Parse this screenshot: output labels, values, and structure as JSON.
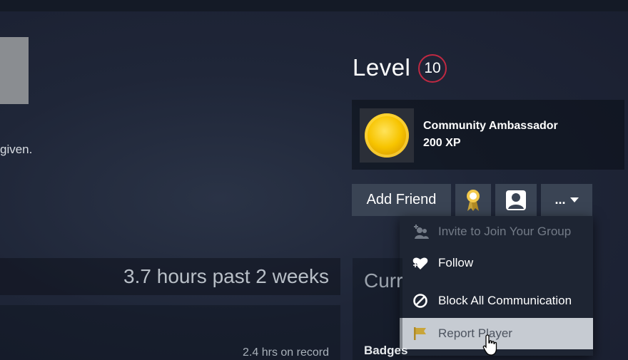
{
  "profile": {
    "summary_fragment": "given.",
    "level_label": "Level",
    "level_value": "10"
  },
  "featured_badge": {
    "icon": "community-ambassador-coin-icon",
    "name": "Community Ambassador",
    "xp": "200 XP"
  },
  "actions": {
    "add_friend": "Add Friend",
    "award_icon": "award-ribbon-icon",
    "profile_icon": "user-profile-icon",
    "more": "...",
    "more_icon": "caret-down-icon"
  },
  "more_menu": {
    "items": [
      {
        "label": "Invite to Join Your Group",
        "icon": "invite-group-icon",
        "disabled": true
      },
      {
        "label": "Follow",
        "icon": "heart-follow-icon"
      },
      {
        "label": "Block All Communication",
        "icon": "block-icon"
      },
      {
        "label": "Report Player",
        "icon": "flag-icon",
        "hovered": true
      }
    ]
  },
  "activity": {
    "hours_summary": "3.7 hours past 2 weeks",
    "game_record": "2.4 hrs on record"
  },
  "right_panel": {
    "heading_fragment": "Curr",
    "badges_fragment": "Badges"
  },
  "colors": {
    "level_ring": "#c02942",
    "button_bg": "#3a4454",
    "menu_bg": "#1e2533",
    "menu_hover_bg": "#c6cbd2",
    "report_flag": "#c9a53a"
  }
}
